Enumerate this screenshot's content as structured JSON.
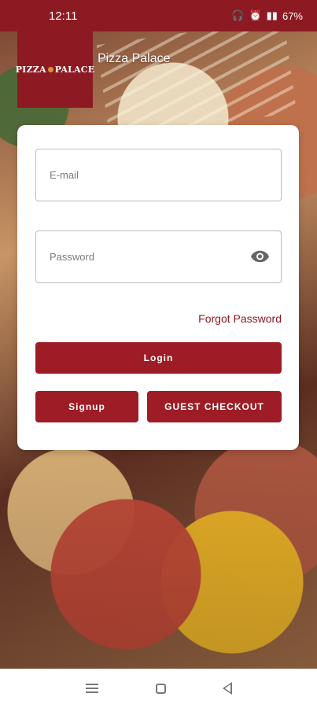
{
  "status_bar": {
    "time": "12:11",
    "battery": "67%"
  },
  "brand": {
    "logo_text_left": "PIZZA",
    "logo_text_right": "PALACE",
    "name": "Pizza Palace"
  },
  "form": {
    "email_placeholder": "E-mail",
    "email_value": "",
    "password_placeholder": "Password",
    "password_value": "",
    "forgot_password_label": "Forgot Password",
    "login_label": "Login",
    "signup_label": "Signup",
    "guest_checkout_label": "GUEST CHECKOUT"
  },
  "icons": {
    "password_visibility": "eye-icon",
    "nav_menu": "menu-icon",
    "nav_home": "home-icon",
    "nav_back": "back-icon"
  },
  "colors": {
    "brand": "#8d1a22",
    "button": "#9d1c25",
    "card": "#ffffff"
  }
}
